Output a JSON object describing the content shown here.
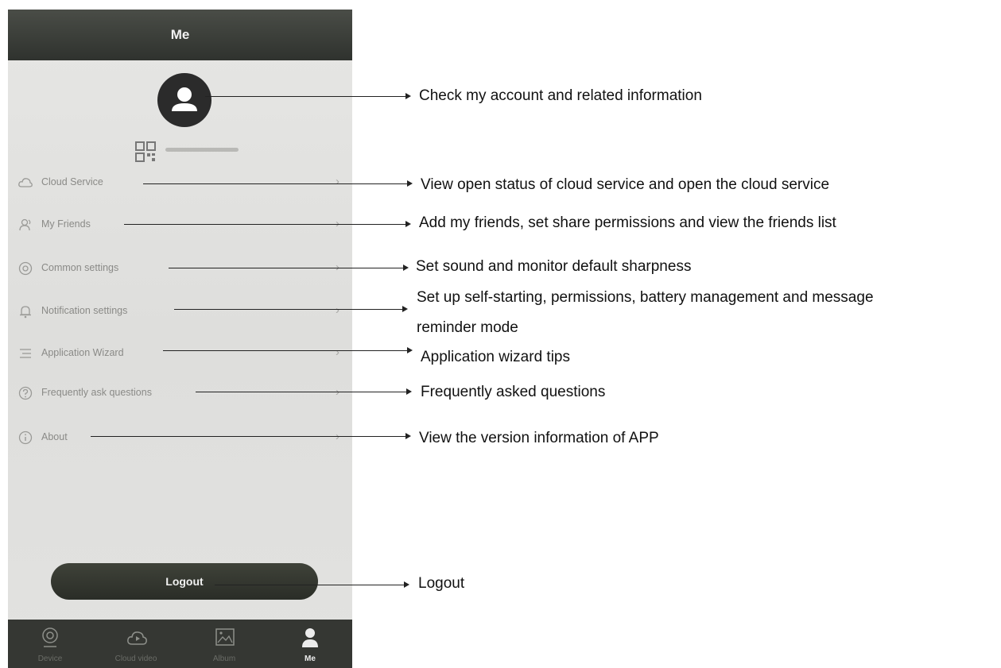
{
  "header": {
    "title": "Me"
  },
  "menu": [
    {
      "icon": "cloud-icon",
      "label": "Cloud Service"
    },
    {
      "icon": "friends-icon",
      "label": "My Friends"
    },
    {
      "icon": "settings-icon",
      "label": "Common settings"
    },
    {
      "icon": "bell-icon",
      "label": "Notification settings"
    },
    {
      "icon": "list-icon",
      "label": "Application Wizard"
    },
    {
      "icon": "question-icon",
      "label": "Frequently ask questions"
    },
    {
      "icon": "info-icon",
      "label": "About"
    }
  ],
  "chevron": "›",
  "logout_label": "Logout",
  "tabs": [
    {
      "icon": "camera-icon",
      "label": "Device"
    },
    {
      "icon": "cloud-video-icon",
      "label": "Cloud video"
    },
    {
      "icon": "album-icon",
      "label": "Album"
    },
    {
      "icon": "person-icon",
      "label": "Me",
      "active": true
    }
  ],
  "callouts": {
    "account": "Check my account and related information",
    "cloud": "View open status of cloud service and open the cloud service",
    "friends": "Add my friends, set share permissions and view the friends list",
    "common": "Set sound and monitor default sharpness",
    "notification_1": "Set up self-starting, permissions, battery management and message",
    "notification_2": "reminder mode",
    "wizard": "Application wizard tips",
    "faq": "Frequently asked questions",
    "about": "View the version information of APP",
    "logout": "Logout"
  },
  "colors": {
    "header": "#2f322e",
    "tabbar": "#353733",
    "button": "#2a2d27",
    "menu_text": "#8a8a87"
  }
}
